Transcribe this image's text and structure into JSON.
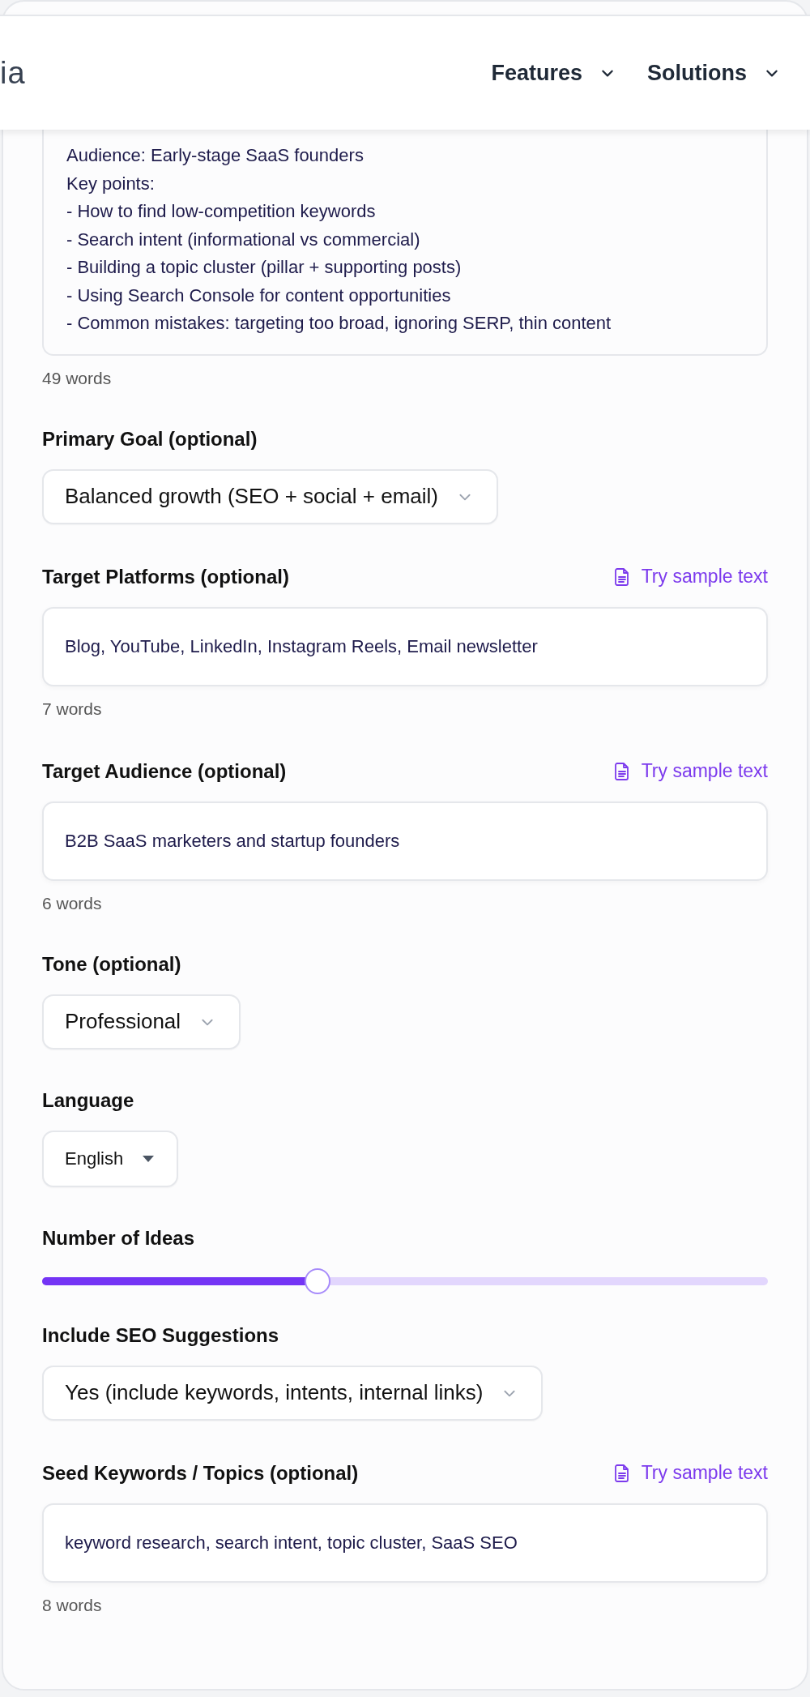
{
  "header": {
    "logo_text": "ia",
    "nav": [
      {
        "label": "Features"
      },
      {
        "label": "Solutions"
      }
    ]
  },
  "intro_field": {
    "value": "Audience: Early-stage SaaS founders\nKey points:\n- How to find low-competition keywords\n- Search intent (informational vs commercial)\n- Building a topic cluster (pillar + supporting posts)\n- Using Search Console for content opportunities\n- Common mistakes: targeting too broad, ignoring SERP, thin content",
    "word_count": "49 words"
  },
  "fields": [
    {
      "kind": "select",
      "label": "Primary Goal (optional)",
      "value": "Balanced growth (SEO + social + email)"
    },
    {
      "kind": "text",
      "label": "Target Platforms (optional)",
      "action": "Try sample text",
      "value": "Blog, YouTube, LinkedIn, Instagram Reels, Email newsletter",
      "word_count": "7 words"
    },
    {
      "kind": "text",
      "label": "Target Audience (optional)",
      "action": "Try sample text",
      "value": "B2B SaaS marketers and startup founders",
      "word_count": "6 words"
    },
    {
      "kind": "select",
      "label": "Tone (optional)",
      "value": "Professional"
    },
    {
      "kind": "dropdown",
      "label": "Language",
      "value": "English"
    },
    {
      "kind": "slider",
      "label": "Number of Ideas",
      "level": 0.38
    },
    {
      "kind": "select",
      "label": "Include SEO Suggestions",
      "value": "Yes (include keywords, intents, internal links)"
    },
    {
      "kind": "text",
      "label": "Seed Keywords / Topics (optional)",
      "action": "Try sample text",
      "value": "keyword research, search intent, topic cluster, SaaS SEO",
      "word_count": "8 words"
    }
  ]
}
